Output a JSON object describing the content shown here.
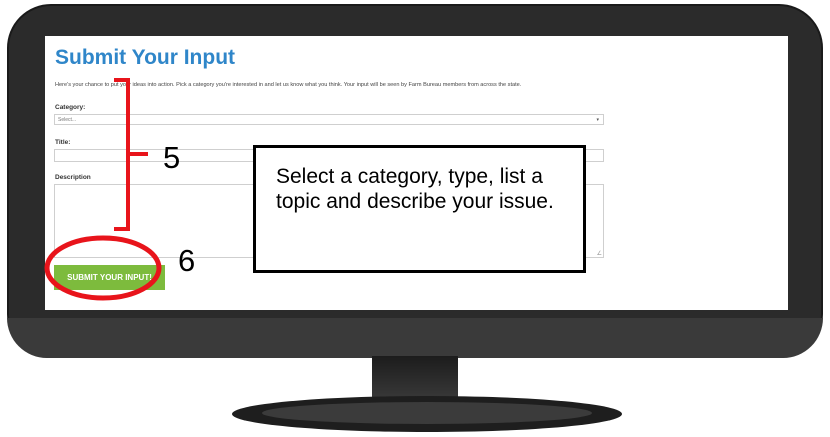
{
  "form": {
    "title": "Submit Your Input",
    "intro": "Here's your chance to put your ideas into action. Pick a category you're interested in and let us know what you think. Your input will be seen by Farm Bureau members from across the state.",
    "category_label": "Category:",
    "category_value": "Select...",
    "title_label": "Title:",
    "description_label": "Description",
    "submit_label": "SUBMIT YOUR INPUT!"
  },
  "annotations": {
    "callout_text": "Select a category, type, list a topic and describe your issue.",
    "step_5": "5",
    "step_6": "6",
    "bracket_color": "#e8141b",
    "circle_color": "#e8141b"
  },
  "icons": {
    "select_arrow": "chevron-down-icon",
    "resize_grip": "resize-grip-icon"
  }
}
